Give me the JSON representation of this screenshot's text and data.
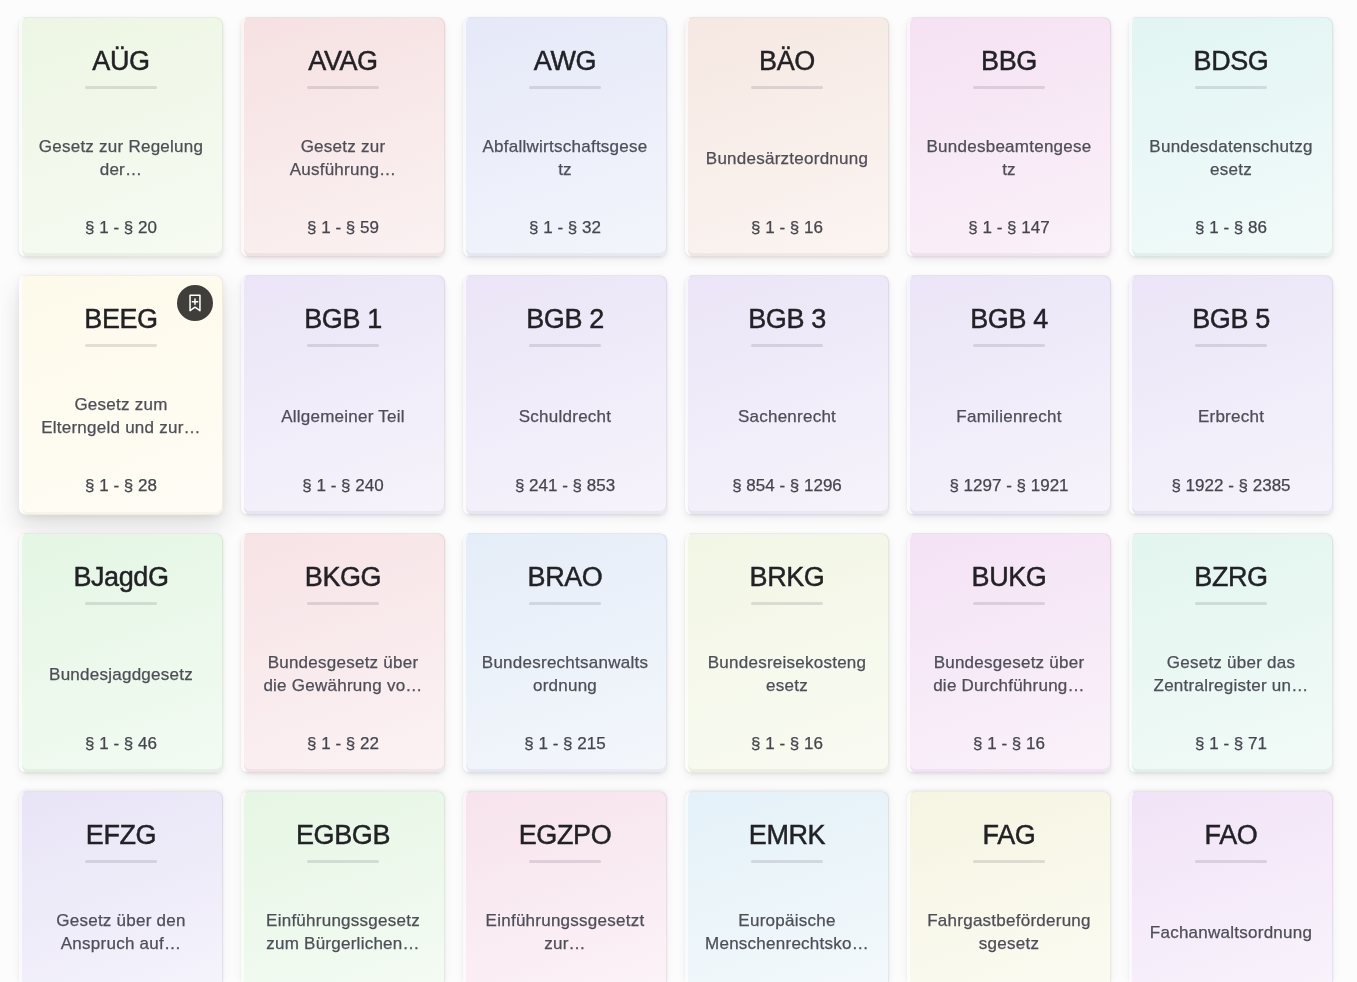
{
  "cards": [
    {
      "abbreviation": "AÜG",
      "title": "Gesetz zur Regelung der…",
      "range": "§ 1 - § 20",
      "color": "#edf6e4",
      "hovered": false
    },
    {
      "abbreviation": "AVAG",
      "title": "Gesetz zur Ausführung…",
      "range": "§ 1 - § 59",
      "color": "#f6e1e2",
      "hovered": false
    },
    {
      "abbreviation": "AWG",
      "title": "Abfallwirtschaftsgesetz",
      "range": "§ 1 - § 32",
      "color": "#e5e9f8",
      "hovered": false
    },
    {
      "abbreviation": "BÄO",
      "title": "Bundesärzteordnung",
      "range": "§ 1 - § 16",
      "color": "#f6e8e2",
      "hovered": false
    },
    {
      "abbreviation": "BBG",
      "title": "Bundesbeamtengesetz",
      "range": "§ 1 - § 147",
      "color": "#f5e1f3",
      "hovered": false
    },
    {
      "abbreviation": "BDSG",
      "title": "Bundesdatenschutzgesetz",
      "range": "§ 1 - § 86",
      "color": "#e1f5f3",
      "hovered": false
    },
    {
      "abbreviation": "BEEG",
      "title": "Gesetz zum Elterngeld und zur…",
      "range": "§ 1 - § 28",
      "color": "#fefaea",
      "hovered": true
    },
    {
      "abbreviation": "BGB 1",
      "title": "Allgemeiner Teil",
      "range": "§ 1 - § 240",
      "color": "#ebe5f7",
      "hovered": false
    },
    {
      "abbreviation": "BGB 2",
      "title": "Schuldrecht",
      "range": "§ 241 - § 853",
      "color": "#ebe5f7",
      "hovered": false
    },
    {
      "abbreviation": "BGB 3",
      "title": "Sachenrecht",
      "range": "§ 854 - § 1296",
      "color": "#ebe5f7",
      "hovered": false
    },
    {
      "abbreviation": "BGB 4",
      "title": "Familienrecht",
      "range": "§ 1297 - § 1921",
      "color": "#ebe5f7",
      "hovered": false
    },
    {
      "abbreviation": "BGB 5",
      "title": "Erbrecht",
      "range": "§ 1922 - § 2385",
      "color": "#ebe5f7",
      "hovered": false
    },
    {
      "abbreviation": "BJagdG",
      "title": "Bundesjagdgesetz",
      "range": "§ 1 - § 46",
      "color": "#e4f6e4",
      "hovered": false
    },
    {
      "abbreviation": "BKGG",
      "title": "Bundesgesetz über die Gewährung vo…",
      "range": "§ 1 - § 22",
      "color": "#f7e3e6",
      "hovered": false
    },
    {
      "abbreviation": "BRAO",
      "title": "Bundesrechtsanwaltsordnung",
      "range": "§ 1 - § 215",
      "color": "#e5edf8",
      "hovered": false
    },
    {
      "abbreviation": "BRKG",
      "title": "Bundesreisekostengesetz",
      "range": "§ 1 - § 16",
      "color": "#f2f6e4",
      "hovered": false
    },
    {
      "abbreviation": "BUKG",
      "title": "Bundesgesetz über die Durchführung…",
      "range": "§ 1 - § 16",
      "color": "#f4e2f5",
      "hovered": false
    },
    {
      "abbreviation": "BZRG",
      "title": "Gesetz über das Zentralregister un…",
      "range": "§ 1 - § 71",
      "color": "#e2f5ee",
      "hovered": false
    },
    {
      "abbreviation": "EFZG",
      "title": "Gesetz über den Anspruch auf…",
      "color": "#e8e4f7",
      "hovered": false
    },
    {
      "abbreviation": "EGBGB",
      "title": "Einführungssgesetz zum Bürgerlichen…",
      "color": "#e6f6e4",
      "hovered": false
    },
    {
      "abbreviation": "EGZPO",
      "title": "Einführungssgesetzt zur…",
      "color": "#f7e3ed",
      "hovered": false
    },
    {
      "abbreviation": "EMRK",
      "title": "Europäische Menschenrechtsko…",
      "color": "#e4f1f8",
      "hovered": false
    },
    {
      "abbreviation": "FAG",
      "title": "Fahrgastbeförderungsgesetz",
      "color": "#f6f5e2",
      "hovered": false
    },
    {
      "abbreviation": "FAO",
      "title": "Fachanwaltsordnung",
      "color": "#f1e3f7",
      "hovered": false
    }
  ]
}
